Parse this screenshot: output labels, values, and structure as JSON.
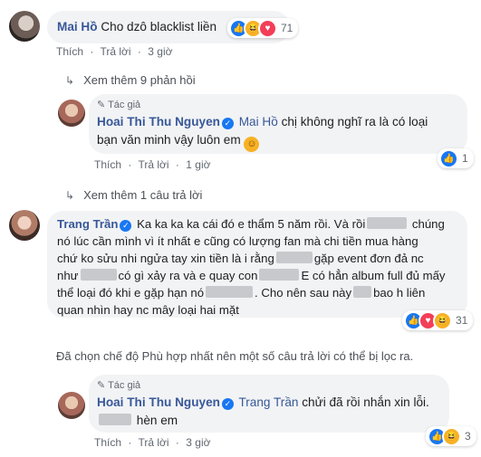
{
  "comment1": {
    "author": "Mai Hồ",
    "text": "Cho dzô blacklist liền",
    "reaction_count": "71",
    "like_label": "Thích",
    "reply_label": "Trả lời",
    "time": "3 giờ"
  },
  "more_replies_1": "Xem thêm 9 phản hồi",
  "reply1": {
    "author_tag": "Tác giả",
    "author": "Hoai Thi Thu Nguyen",
    "mention": "Mai Hồ",
    "text_a": "chị không nghĩ ra là có loại",
    "text_b": "bạn văn minh vậy luôn em",
    "reaction_count": "1",
    "like_label": "Thích",
    "reply_label": "Trả lời",
    "time": "1 giờ"
  },
  "more_replies_2": "Xem thêm 1 câu trả lời",
  "comment2": {
    "author": "Trang Trần",
    "line1_a": "Ka ka ka ka cái đó e thẩm 5 năm rồi. Và rồi",
    "line1_b": "chúng",
    "line2": "nó lúc cần mình vì ít nhất e cũng có lượng fan mà chi tiền mua hàng",
    "line3_a": "chứ ko sửu nhi ngửa tay xin tiền là i rằng",
    "line3_b": "gặp event đơn đả nc",
    "line4_a": "như",
    "line4_b": "có gì xảy ra và e quay con",
    "line4_c": "E có hẳn album full đủ mấy",
    "line5_a": "thể loại đó khi e gặp hạn nó",
    "line5_b": ". Cho nên sau này",
    "line5_c": "bao h liên",
    "line6": "quan nhìn hay nc mây loại hai mặt",
    "reaction_count": "31"
  },
  "filter_notice": "Đã chọn chế độ Phù hợp nhất nên một số câu trả lời có thể bị lọc ra.",
  "reply2": {
    "author_tag": "Tác giả",
    "author": "Hoai Thi Thu Nguyen",
    "mention": "Trang Trần",
    "text_a": "chửi đã rồi nhắn xin lỗi.",
    "text_b": "hèn em",
    "reaction_count": "3",
    "like_label": "Thích",
    "reply_label": "Trả lời",
    "time": "3 giờ"
  },
  "icons": {
    "like": "like-icon",
    "love": "love-icon",
    "haha": "haha-icon",
    "verified": "verified-badge-icon",
    "arrow": "reply-arrow-icon"
  },
  "colors": {
    "link": "#385898",
    "bubble": "#f2f3f5",
    "like": "#1877f2",
    "love": "#f33e58",
    "haha": "#f7b125"
  }
}
